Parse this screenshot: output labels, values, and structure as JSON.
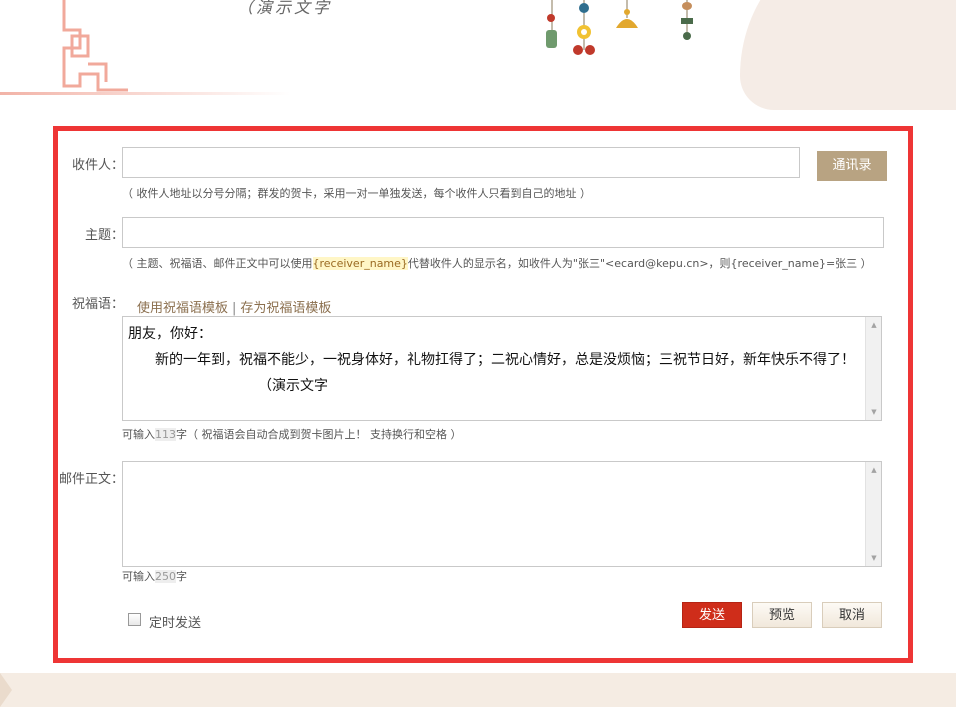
{
  "banner": {
    "demo_text": "（演示文字"
  },
  "form": {
    "recipient": {
      "label": "收件人：",
      "value": "",
      "contacts_button": "通讯录",
      "hint": "（ 收件人地址以分号分隔；群发的贺卡，采用一对一单独发送，每个收件人只看到自己的地址 ）"
    },
    "subject": {
      "label": "主题：",
      "value": "",
      "hint_prefix": "（ 主题、祝福语、邮件正文中可以使用",
      "hint_token": "{receiver_name}",
      "hint_suffix": "代替收件人的显示名，如收件人为\"张三\"<ecard@kepu.cn>，则{receiver_name}=张三 ）"
    },
    "greeting": {
      "label": "祝福语：",
      "use_template": "使用祝福语模板",
      "separator": "|",
      "save_template": "存为祝福语模板",
      "line1": "朋友，你好：",
      "line2": "新的一年到，祝福不能少，一祝身体好，礼物扛得了；二祝心情好，总是没烦恼；三祝节日好，新年快乐不得了！",
      "line3": "（演示文字",
      "counter_prefix": "可输入",
      "counter_value": "113",
      "counter_suffix": "字（ 祝福语会自动合成到贺卡图片上！ 支持换行和空格 ）"
    },
    "body": {
      "label": "邮件正文：",
      "value": "",
      "counter_prefix": "可输入",
      "counter_value": "250",
      "counter_suffix": "字"
    },
    "schedule": {
      "label": "定时发送",
      "checked": false
    },
    "actions": {
      "send": "发送",
      "preview": "预览",
      "cancel": "取消"
    }
  },
  "colors": {
    "frame_border": "#ee3535",
    "contacts_button": "#b8a382",
    "send_button": "#cf2d1a",
    "template_link": "#8b6f4e"
  }
}
